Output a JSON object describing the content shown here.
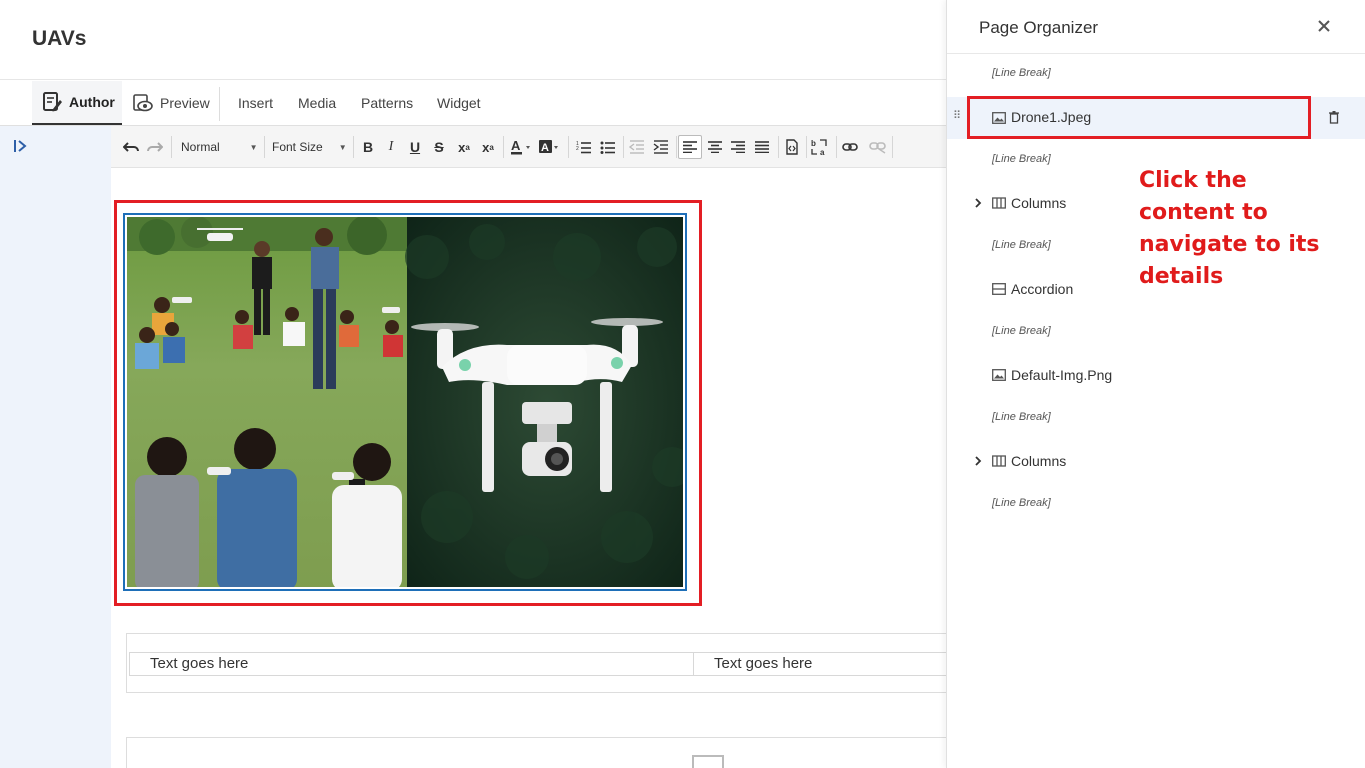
{
  "header": {
    "title": "UAVs"
  },
  "mode_tabs": [
    {
      "label": "Author",
      "icon": "edit-doc-icon",
      "active": true
    },
    {
      "label": "Preview",
      "icon": "eye-icon",
      "active": false
    }
  ],
  "menu_tabs": [
    "Insert",
    "Media",
    "Patterns",
    "Widget"
  ],
  "toolbar": {
    "format_select": "Normal",
    "font_size_select": "Font Size",
    "buttons": [
      "undo-icon",
      "redo-icon",
      "bold-icon",
      "italic-icon",
      "underline-icon",
      "strikethrough-icon",
      "subscript-icon",
      "superscript-icon",
      "font-color-icon",
      "highlight-color-icon",
      "ordered-list-icon",
      "unordered-list-icon",
      "outdent-icon",
      "indent-icon",
      "align-left-icon",
      "align-center-icon",
      "align-right-icon",
      "justify-icon",
      "source-code-icon",
      "text-direction-icon",
      "link-icon",
      "unlink-icon"
    ]
  },
  "canvas": {
    "columns": [
      "Text goes here",
      "Text goes here"
    ]
  },
  "organizer": {
    "title": "Page Organizer",
    "line_break_label": "[Line Break]",
    "items": [
      {
        "type": "line-break",
        "label": "[Line Break]"
      },
      {
        "type": "image",
        "label": "Drone1.Jpeg",
        "selected": true
      },
      {
        "type": "line-break",
        "label": "[Line Break]"
      },
      {
        "type": "columns",
        "label": "Columns"
      },
      {
        "type": "line-break",
        "label": "[Line Break]"
      },
      {
        "type": "accordion",
        "label": "Accordion"
      },
      {
        "type": "line-break",
        "label": "[Line Break]"
      },
      {
        "type": "image",
        "label": "Default-Img.Png"
      },
      {
        "type": "line-break",
        "label": "[Line Break]"
      },
      {
        "type": "columns",
        "label": "Columns"
      },
      {
        "type": "line-break",
        "label": "[Line Break]"
      }
    ]
  },
  "annotation": {
    "text": "Click the content to navigate to its details"
  },
  "colors": {
    "highlight": "#e31e24",
    "accent": "#1e6fb8",
    "rail": "#eef3fb"
  }
}
